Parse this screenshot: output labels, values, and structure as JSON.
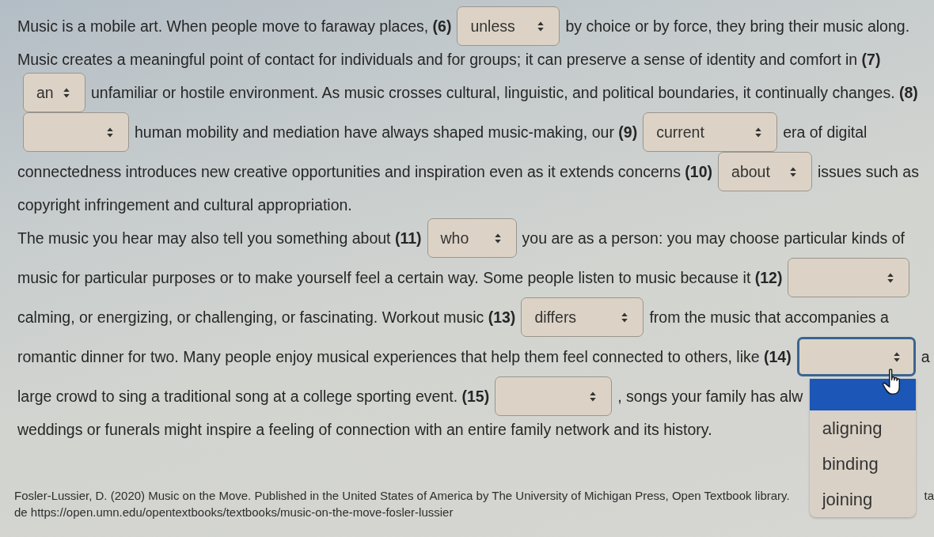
{
  "passage": {
    "paragraphs": [
      {
        "lines": [
          [
            {
              "kind": "text",
              "text": "Music is a mobile art. When people move to faraway places, **(6)**"
            },
            {
              "kind": "select",
              "value": "unless",
              "expanded": false
            },
            {
              "kind": "text",
              "text": "by choice or by force, they bring their music along."
            }
          ],
          [
            {
              "kind": "text",
              "text": "Music creates a meaningful point of contact for individuals and for groups; it can preserve a sense of identity and comfort in **(7)**"
            }
          ],
          [
            {
              "kind": "select",
              "value": "an",
              "expanded": false
            },
            {
              "kind": "text",
              "text": "unfamiliar or hostile environment. As music crosses cultural, linguistic, and political boundaries, it continually changes. **(8)**"
            }
          ],
          [
            {
              "kind": "select",
              "expanded": false
            },
            {
              "kind": "text",
              "text": "human mobility and mediation have always shaped music-making, our **(9)**"
            },
            {
              "kind": "select",
              "value": "current",
              "expanded": false
            },
            {
              "kind": "text",
              "text": "era of digital"
            }
          ],
          [
            {
              "kind": "text",
              "text": "connectedness introduces new creative opportunities and inspiration even as it extends concerns **(10)**"
            },
            {
              "kind": "select",
              "value": "about",
              "expanded": false
            },
            {
              "kind": "text",
              "text": "issues such as"
            }
          ],
          [
            {
              "kind": "text",
              "text": "copyright infringement and cultural appropriation."
            }
          ]
        ]
      },
      {
        "lines": [
          [
            {
              "kind": "text",
              "text": "The music you hear may also tell you something about **(11)**"
            },
            {
              "kind": "select",
              "value": "who",
              "expanded": false
            },
            {
              "kind": "text",
              "text": "you are as a person: you may choose particular kinds of"
            }
          ],
          [
            {
              "kind": "text",
              "text": "music for particular purposes or to make yourself feel a certain way. Some people listen to music because it **(12)**"
            },
            {
              "kind": "select",
              "expanded": false
            }
          ],
          [
            {
              "kind": "text",
              "text": "calming, or energizing, or challenging, or fascinating. Workout music **(13)**"
            },
            {
              "kind": "select",
              "value": "differs",
              "expanded": false
            },
            {
              "kind": "text",
              "text": "from the music that accompanies a"
            }
          ],
          [
            {
              "kind": "text",
              "text": "romantic dinner for two. Many people enjoy musical experiences that help them feel connected to others, like **(14)**"
            },
            {
              "kind": "select",
              "expanded": true,
              "options": [
                {
                  "selected": true
                },
                {
                  "label": "aligning",
                  "selected": false
                },
                {
                  "label": "binding",
                  "selected": false
                },
                {
                  "label": "joining",
                  "selected": false
                }
              ]
            },
            {
              "kind": "text",
              "text": "a"
            }
          ],
          [
            {
              "kind": "text",
              "text": "large crowd to sing a traditional song at a college sporting event. **(15)**"
            },
            {
              "kind": "select",
              "expanded": false
            },
            {
              "kind": "text",
              "text": ", songs your family has alw"
            }
          ],
          [
            {
              "kind": "text",
              "text": "weddings or funerals might inspire a feeling of connection with an entire family network and its history."
            }
          ]
        ]
      }
    ]
  },
  "citation": {
    "lines": [
      [
        "Fosler-Lussier, D. (2020) Music on the Move. Published in the United States of America by The University of Michigan Press, Open Textbook library.",
        "ta"
      ],
      [
        "de https://open.umn.edu/opentextbooks/textbooks/music-on-the-move-fosler-lussier"
      ]
    ]
  }
}
